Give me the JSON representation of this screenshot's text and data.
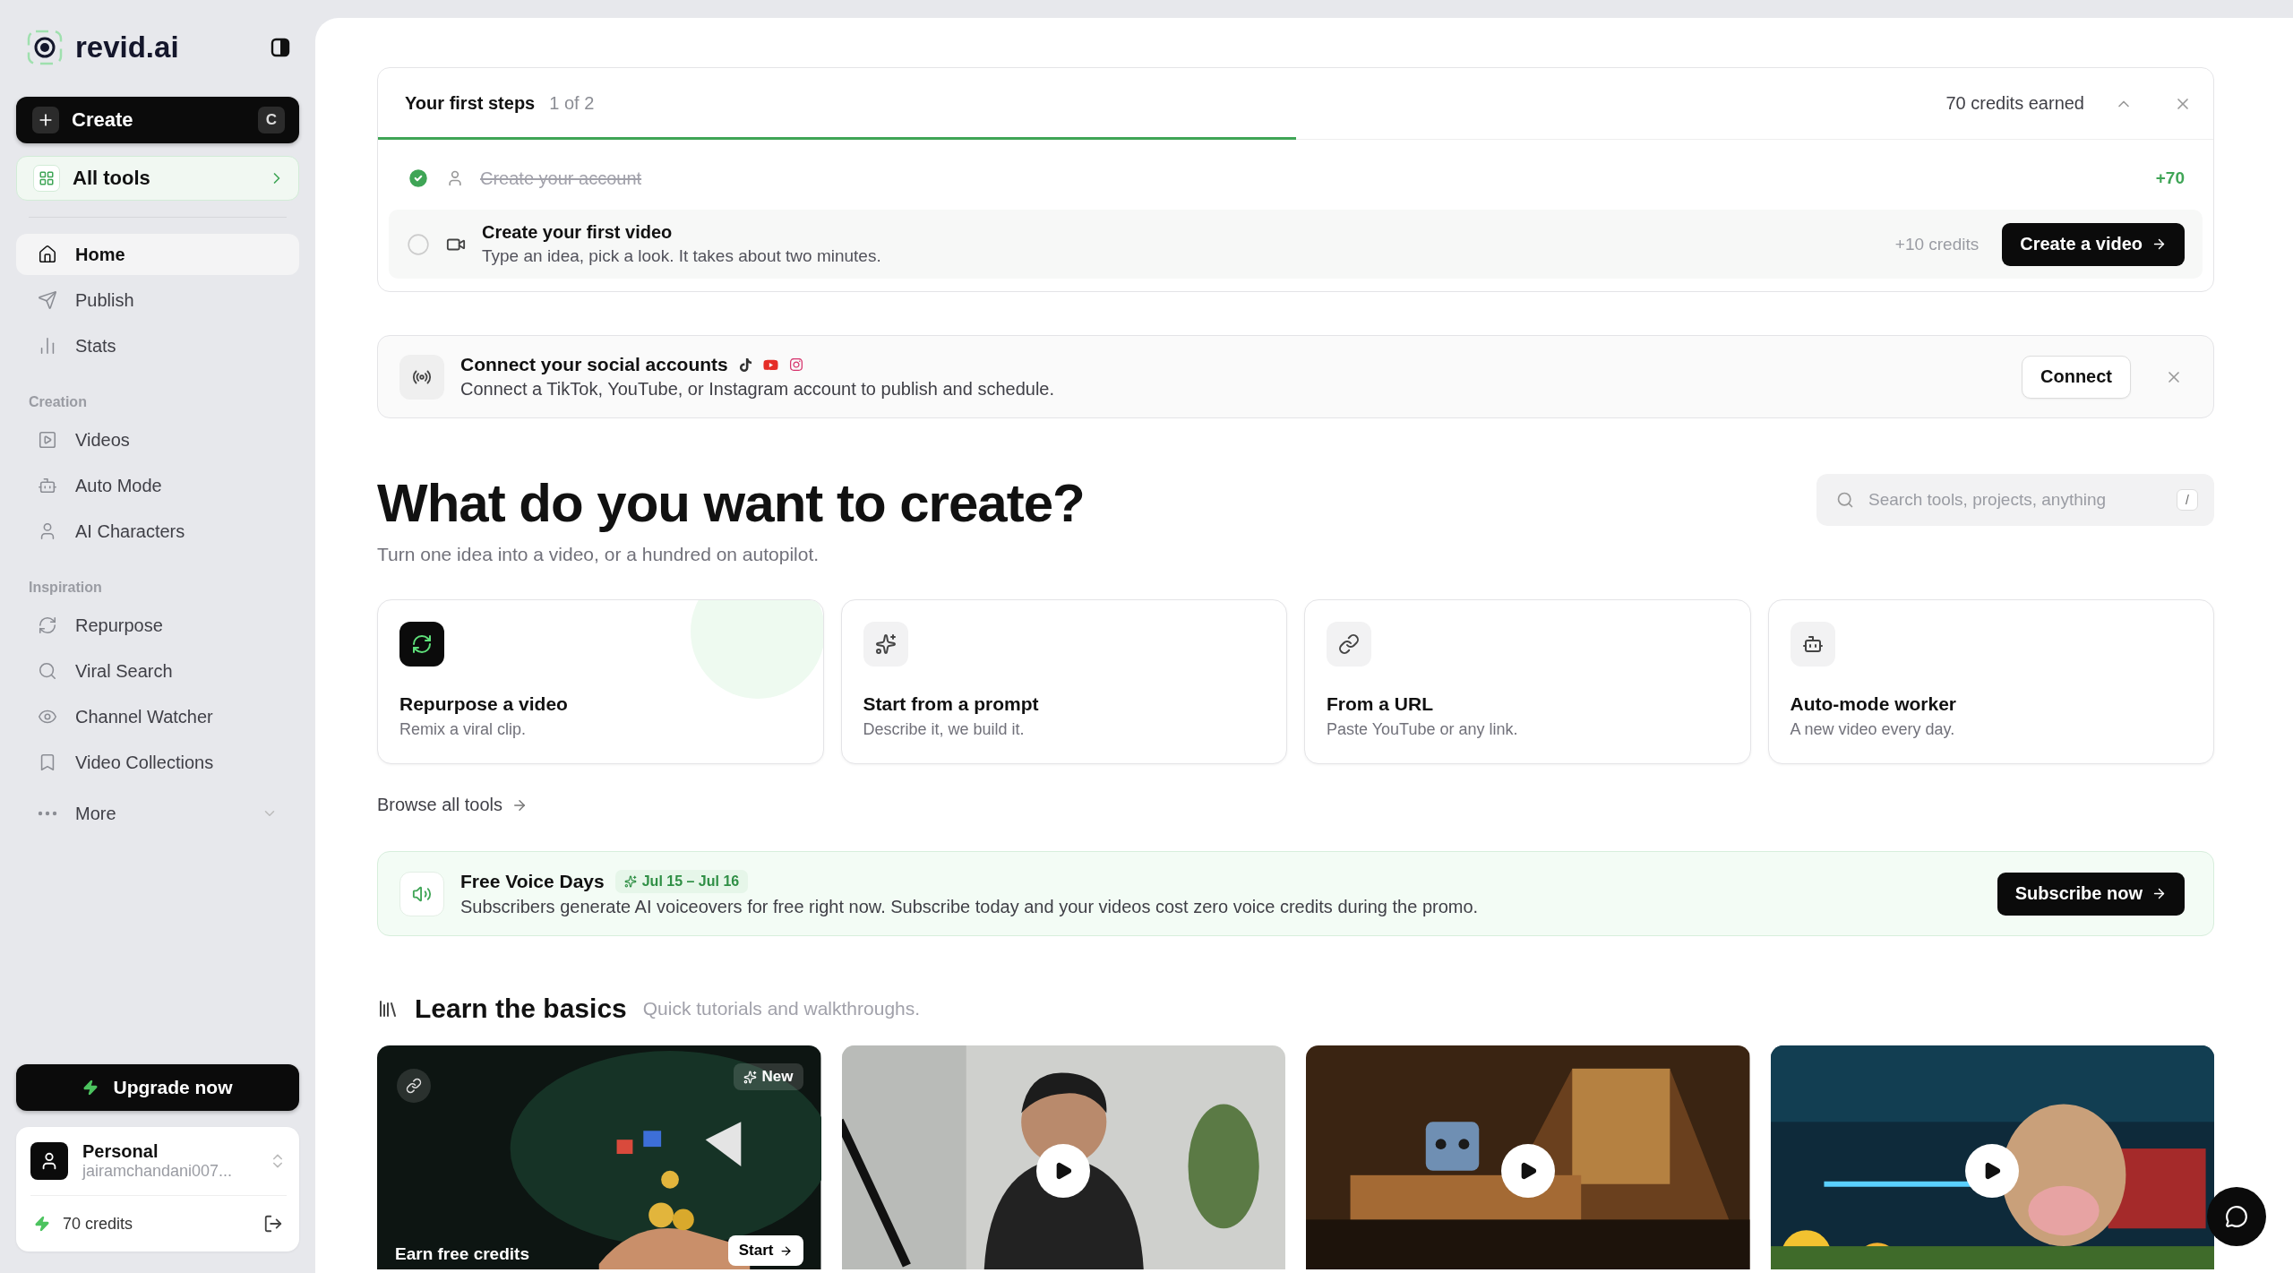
{
  "sidebar": {
    "brand": "revid.ai",
    "create_button": {
      "label": "Create",
      "shortcut": "C"
    },
    "all_tools": "All tools",
    "nav": [
      {
        "label": "Home",
        "selected": true
      },
      {
        "label": "Publish",
        "selected": false
      },
      {
        "label": "Stats",
        "selected": false
      }
    ],
    "sections": [
      {
        "title": "Creation",
        "items": [
          {
            "label": "Videos",
            "selected": false
          },
          {
            "label": "Auto Mode",
            "selected": false
          },
          {
            "label": "AI Characters",
            "selected": false
          }
        ]
      },
      {
        "title": "Inspiration",
        "items": [
          {
            "label": "Repurpose",
            "selected": false
          },
          {
            "label": "Viral Search",
            "selected": false
          },
          {
            "label": "Channel Watcher",
            "selected": false
          },
          {
            "label": "Video Collections",
            "selected": false
          }
        ]
      }
    ],
    "more": {
      "label": "More",
      "expanded": false
    },
    "upgrade_button": "Upgrade now",
    "account": {
      "name": "Personal",
      "email": "jairamchandani007...",
      "credits": "70 credits"
    }
  },
  "first_steps": {
    "title": "Your first steps",
    "progress": "1 of 2",
    "level": 0.5,
    "earned": "70 credits earned",
    "steps": [
      {
        "title": "Create your account",
        "done": true,
        "reward": "+70"
      },
      {
        "title": "Create your first video",
        "description": "Type an idea, pick a look. It takes about two minutes.",
        "done": false,
        "reward": "+10 credits",
        "action": "Create a video"
      }
    ]
  },
  "social": {
    "title": "Connect your social accounts",
    "text": "Connect a TikTok, YouTube, or Instagram account to publish and schedule.",
    "button": "Connect"
  },
  "hero": {
    "title": "What do you want to create?",
    "subtitle": "Turn one idea into a video, or a hundred on autopilot.",
    "search": {
      "placeholder": "Search tools, projects, anything",
      "shortcut": "/"
    }
  },
  "tools": [
    {
      "title": "Repurpose a video",
      "description": "Remix a viral clip.",
      "highlighted": true
    },
    {
      "title": "Start from a prompt",
      "description": "Describe it, we build it.",
      "highlighted": false
    },
    {
      "title": "From a URL",
      "description": "Paste YouTube or any link.",
      "highlighted": false
    },
    {
      "title": "Auto-mode worker",
      "description": "A new video every day.",
      "highlighted": false
    }
  ],
  "browse_link": "Browse all tools",
  "promo": {
    "title": "Free Voice Days",
    "dates": "Jul 15 – Jul 16",
    "text": "Subscribers generate AI voiceovers for free right now. Subscribe today and your videos cost zero voice credits during the promo.",
    "button": "Subscribe now"
  },
  "learn": {
    "title": "Learn the basics",
    "subtitle": "Quick tutorials and walkthroughs.",
    "cards": [
      {
        "kind": "promo",
        "badge": "New",
        "caption": "Earn free credits",
        "action": "Start"
      },
      {
        "kind": "video"
      },
      {
        "kind": "video"
      },
      {
        "kind": "video"
      }
    ]
  }
}
